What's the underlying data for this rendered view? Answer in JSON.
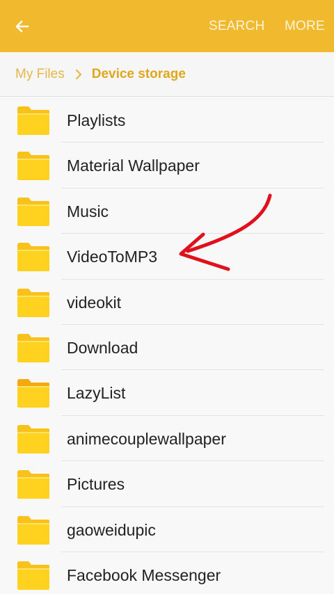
{
  "colors": {
    "accent": "#f1b92e",
    "arrow": "#e0101c",
    "folder": "#ffd21f"
  },
  "appbar": {
    "back_icon": "arrow-left-icon",
    "search_label": "SEARCH",
    "more_label": "MORE"
  },
  "breadcrumb": {
    "root": "My Files",
    "separator_icon": "chevron-right-icon",
    "current": "Device storage"
  },
  "folders": [
    {
      "name": "Playlists"
    },
    {
      "name": "Material Wallpaper"
    },
    {
      "name": "Music"
    },
    {
      "name": "VideoToMP3"
    },
    {
      "name": "videokit"
    },
    {
      "name": "Download"
    },
    {
      "name": "LazyList"
    },
    {
      "name": "animecouplewallpaper"
    },
    {
      "name": "Pictures"
    },
    {
      "name": "gaoweidupic"
    },
    {
      "name": "Facebook Messenger"
    }
  ],
  "annotation": {
    "icon": "red-arrow-icon",
    "points_to": "VideoToMP3"
  }
}
